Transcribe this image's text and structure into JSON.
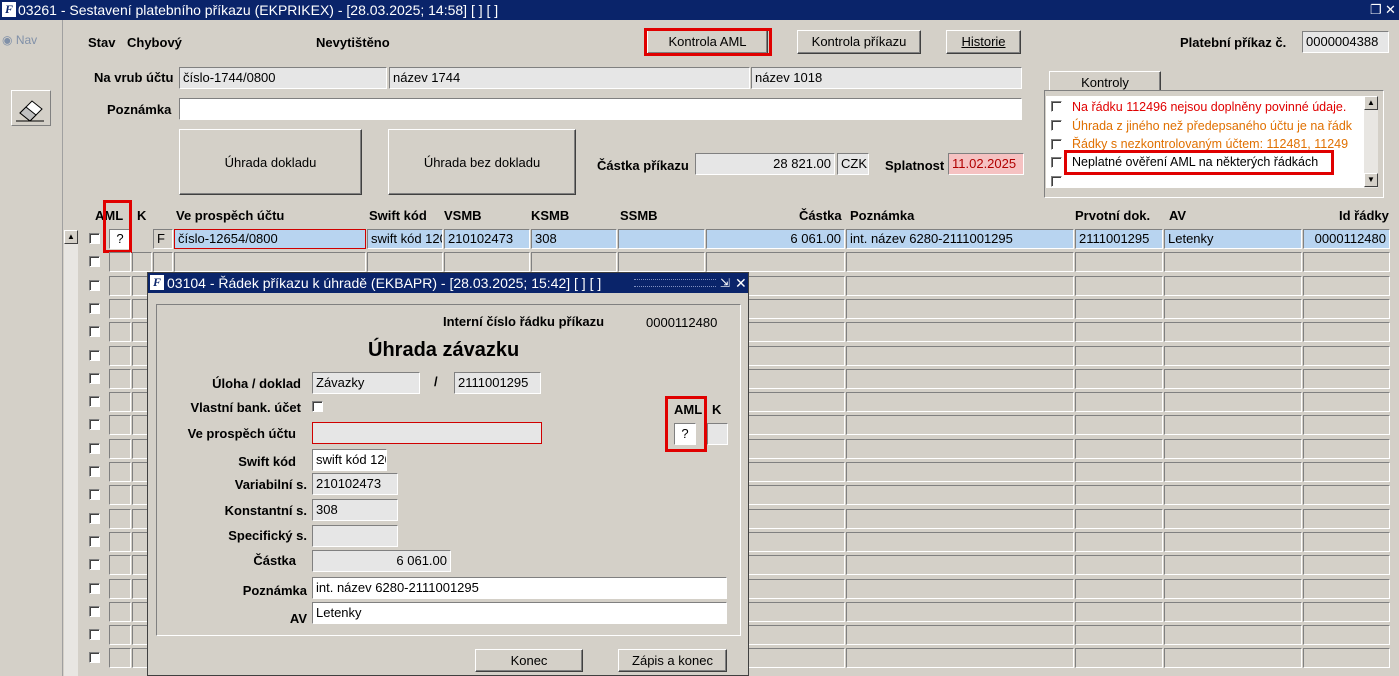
{
  "window": {
    "title": "03261 - Sestavení platebního příkazu (EKPRIKEX) - [28.03.2025; 14:58]  [ ]  [ ]",
    "app_icon": "F"
  },
  "nav": {
    "label": "Nav"
  },
  "header": {
    "stav_label": "Stav",
    "stav_value": "Chybový",
    "print_status": "Nevytištěno",
    "kontrola_aml_btn": "Kontrola AML",
    "kontrola_prikazu_btn": "Kontrola příkazu",
    "historie_btn": "Historie",
    "platebni_prikaz_label": "Platební příkaz č.",
    "platebni_prikaz_value": "0000004388"
  },
  "form": {
    "na_vrub_label": "Na vrub účtu",
    "na_vrub_ucet": "číslo-1744/0800",
    "na_vrub_nazev1": "název 1744",
    "na_vrub_nazev2": "název 1018",
    "poznamka_label": "Poznámka",
    "poznamka_value": "",
    "uhrada_dokladu_btn": "Úhrada dokladu",
    "uhrada_bez_dokladu_btn": "Úhrada bez dokladu",
    "castka_label": "Částka příkazu",
    "castka_value": "28 821.00",
    "mena": "CZK",
    "splatnost_label": "Splatnost",
    "splatnost_value": "11.02.2025"
  },
  "kontroly": {
    "tab_label": "Kontroly",
    "items": [
      {
        "text": "Na řádku 112496 nejsou doplněny povinné údaje.",
        "color": "#e00000"
      },
      {
        "text": "Úhrada z jiného než předepsaného účtu je na řádk",
        "color": "#e07000"
      },
      {
        "text": "Řádky s nezkontrolovaným účtem: 112481, 11249",
        "color": "#e07000"
      },
      {
        "text": "Neplatné ověření AML na některých řádkách",
        "color": "#000000"
      },
      {
        "text": "",
        "color": "#000000"
      }
    ]
  },
  "grid": {
    "columns": [
      "AML",
      "K",
      "Ve prospěch účtu",
      "Swift kód",
      "VSMB",
      "KSMB",
      "SSMB",
      "Částka",
      "Poznámka",
      "Prvotní dok.",
      "AV",
      "Id řádky"
    ],
    "row1": {
      "aml": "?",
      "k": "F",
      "ucet": "číslo-12654/0800",
      "swift": "swift kód 120",
      "vsmb": "210102473",
      "ksmb": "308",
      "ssmb": "",
      "castka": "6 061.00",
      "poznamka": "int. název 6280-2111001295",
      "prvotni": "2111001295",
      "av": "Letenky",
      "id": "0000112480"
    }
  },
  "dialog": {
    "title": "03104 - Řádek příkazu k úhradě (EKBAPR) - [28.03.2025; 15:42]  [ ]  [ ]",
    "interni_label": "Interní číslo řádku příkazu",
    "interni_value": "0000112480",
    "heading": "Úhrada závazku",
    "uloha_label": "Úloha / doklad",
    "uloha_value": "Závazky",
    "slash": "/",
    "doklad_value": "2111001295",
    "vlastni_label": "Vlastní bank. účet",
    "ve_prospech_label": "Ve prospěch účtu",
    "ve_prospech_value": "",
    "swift_label": "Swift kód",
    "swift_value": "swift kód 120",
    "variabilni_label": "Variabilní s.",
    "variabilni_value": "210102473",
    "konstantni_label": "Konstantní s.",
    "konstantni_value": "308",
    "specificky_label": "Specifický s.",
    "specificky_value": "",
    "castka_label": "Částka",
    "castka_value": "6 061.00",
    "poznamka_label": "Poznámka",
    "poznamka_value": "int. název 6280-2111001295",
    "av_label": "AV",
    "av_value": "Letenky",
    "aml_label": "AML",
    "aml_value": "?",
    "k_label": "K",
    "k_value": "",
    "konec_btn": "Konec",
    "zapis_btn": "Zápis a konec"
  }
}
